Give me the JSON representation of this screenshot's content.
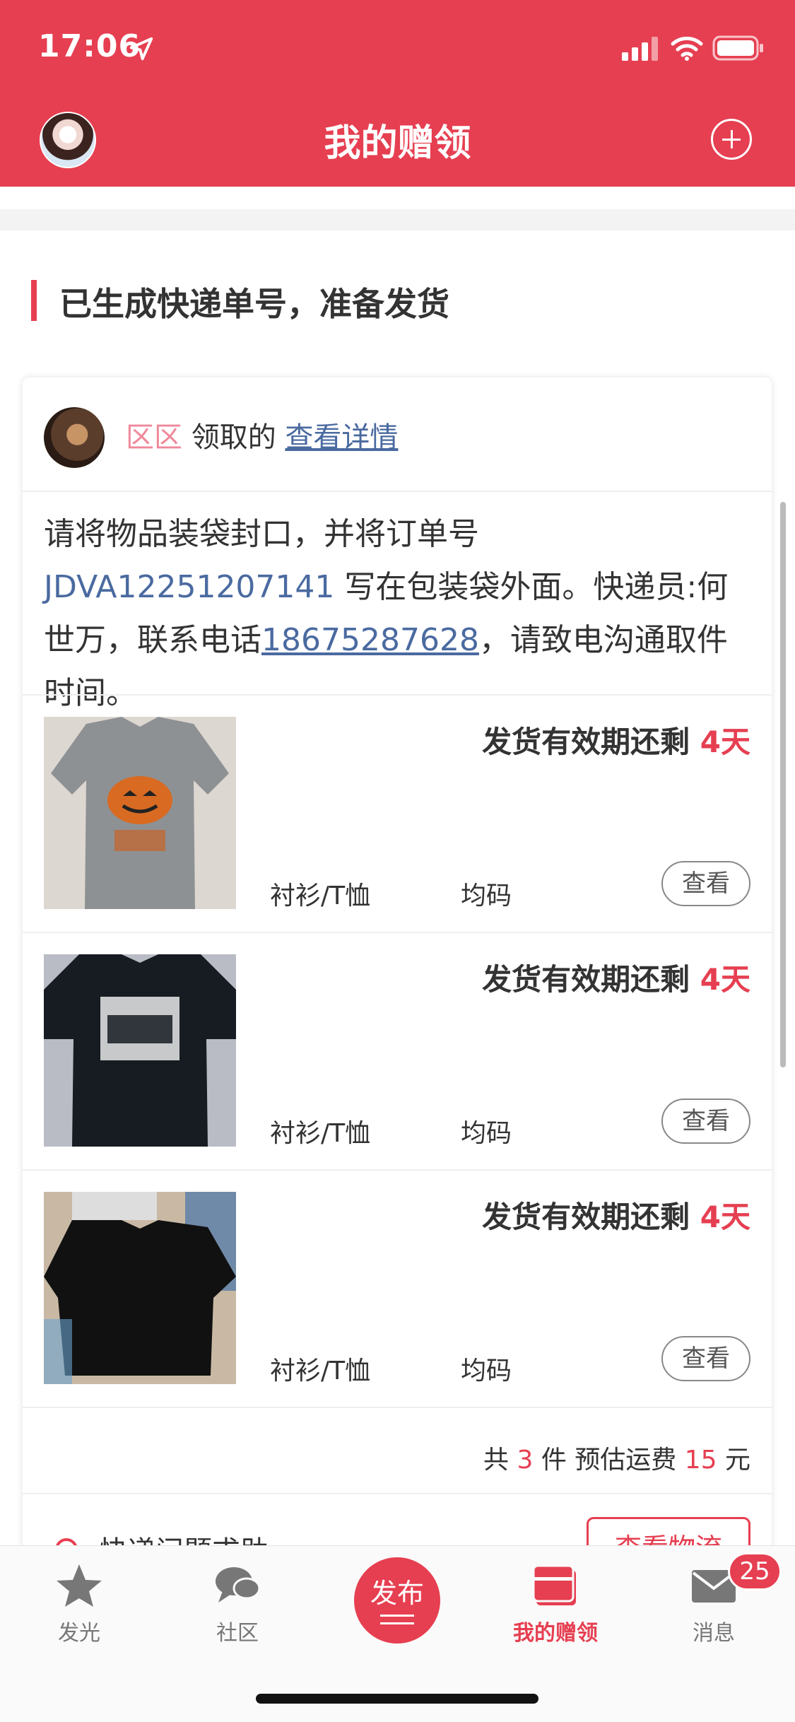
{
  "status_bar": {
    "time": "17:06"
  },
  "header": {
    "title": "我的赠领"
  },
  "section": {
    "title": "已生成快递单号，准备发货"
  },
  "card": {
    "user_name": "区区",
    "action_text": "领取的",
    "detail_link": "查看详情",
    "notice": {
      "part1": "请将物品装袋封口，并将订单号 ",
      "order_code": "JDVA12251207141",
      "part2": " 写在包装袋外面。快递员:何世万，联系电话",
      "phone": "18675287628",
      "part3": "，请致电沟通取件时间。"
    },
    "items": [
      {
        "deadline_label": "发货有效期还剩",
        "deadline_days": "4天",
        "category": "衬衫/T恤",
        "size": "均码",
        "view_label": "查看"
      },
      {
        "deadline_label": "发货有效期还剩",
        "deadline_days": "4天",
        "category": "衬衫/T恤",
        "size": "均码",
        "view_label": "查看"
      },
      {
        "deadline_label": "发货有效期还剩",
        "deadline_days": "4天",
        "category": "衬衫/T恤",
        "size": "均码",
        "view_label": "查看"
      }
    ],
    "summary": {
      "prefix": "共",
      "count": "3",
      "mid": "件 预估运费",
      "fee": "15",
      "suffix": "元"
    },
    "help_text": "快递问题求助",
    "track_button": "查看物流"
  },
  "tabbar": {
    "tabs": [
      {
        "label": "发光",
        "icon": "star-icon"
      },
      {
        "label": "社区",
        "icon": "chat-icon"
      },
      {
        "label": "我的赠领",
        "icon": "gift-box-icon"
      },
      {
        "label": "消息",
        "icon": "mail-icon"
      }
    ],
    "publish_label": "发布",
    "message_badge": "25"
  },
  "colors": {
    "accent": "#e63f51",
    "link": "#4a6aa0"
  }
}
